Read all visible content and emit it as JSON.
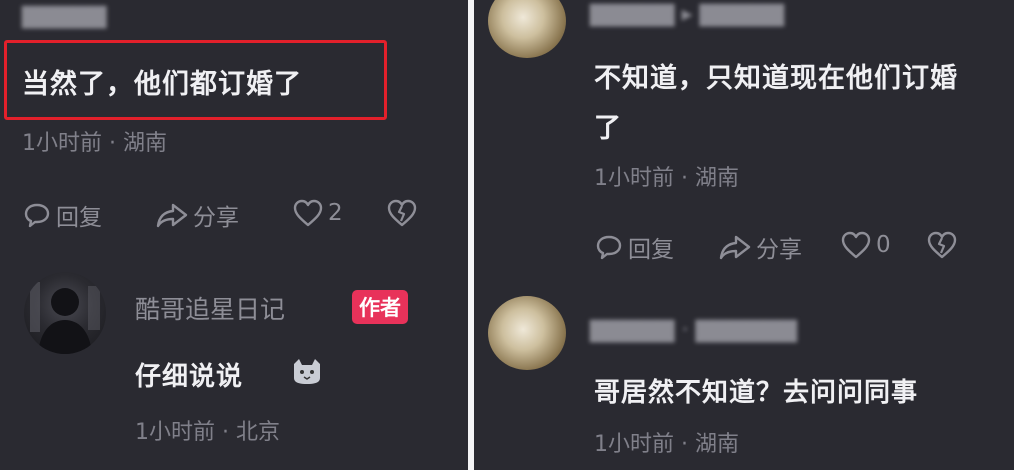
{
  "left": {
    "top_comment": {
      "text": "当然了，他们都订婚了",
      "meta": "1小时前 · 湖南",
      "reply_label": "回复",
      "share_label": "分享",
      "like_count": "2"
    },
    "reply": {
      "author": "酷哥追星日记",
      "badge": "作者",
      "text": "仔细说说",
      "meta": "1小时前 · 北京"
    }
  },
  "right": {
    "comment_one": {
      "text_line1": "不知道，只知道现在他们订婚",
      "text_line2": "了",
      "meta": "1小时前 · 湖南",
      "reply_label": "回复",
      "share_label": "分享",
      "like_count": "0"
    },
    "comment_two": {
      "text": "哥居然不知道？去问问同事",
      "meta": "1小时前 · 湖南"
    }
  },
  "colors": {
    "highlight": "#e3202b",
    "badge": "#e8325a",
    "background": "#2a2a31"
  }
}
